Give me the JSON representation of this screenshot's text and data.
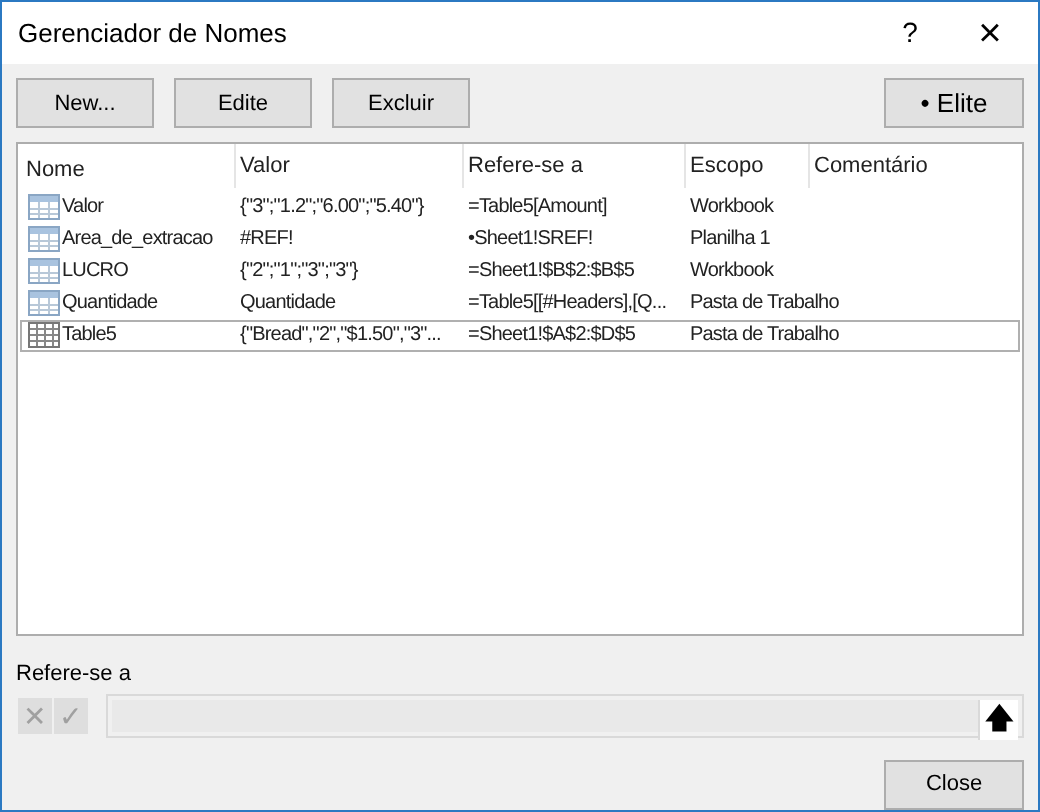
{
  "window": {
    "title": "Gerenciador de Nomes",
    "help": "?",
    "close": "×"
  },
  "toolbar": {
    "buttons": [
      "New...",
      "Edite",
      "Excluir"
    ],
    "filter_button": "• Elite"
  },
  "table": {
    "columns": [
      "Nome",
      "Valor",
      "Refere-se a",
      "Escopo",
      "Comentário"
    ],
    "rows": [
      {
        "kind": "range",
        "selected": false,
        "cells": [
          "Valor",
          "{\"3\";\"1.2\";\"6.00\";\"5.40\"}",
          "=Table5[Amount]",
          "Workbook"
        ]
      },
      {
        "kind": "range",
        "selected": false,
        "cells": [
          "Area_de_extracao",
          "#REF!",
          "•Sheet1!SREF!",
          "Planilha 1"
        ]
      },
      {
        "kind": "range",
        "selected": false,
        "cells": [
          "LUCRO",
          "{\"2\";\"1\";\"3\";\"3\"}",
          "=Sheet1!$B$2:$B$5",
          "Workbook"
        ]
      },
      {
        "kind": "range",
        "selected": false,
        "cells": [
          "Quantidade",
          "Quantidade",
          "=Table5[[#Headers],[Q...",
          "Pasta de Trabalho"
        ]
      },
      {
        "kind": "table",
        "selected": true,
        "cells": [
          "Table5",
          "{\"Bread\",\"2\",\"$1.50\",\"3\"...",
          "=Sheet1!$A$2:$D$5",
          "Pasta de Trabalho"
        ]
      }
    ]
  },
  "refers_to": {
    "label": "Refere-se a",
    "cancel": "✕",
    "confirm": "✓",
    "collapse": "🡅"
  },
  "footer": {
    "close_button": "Close"
  }
}
